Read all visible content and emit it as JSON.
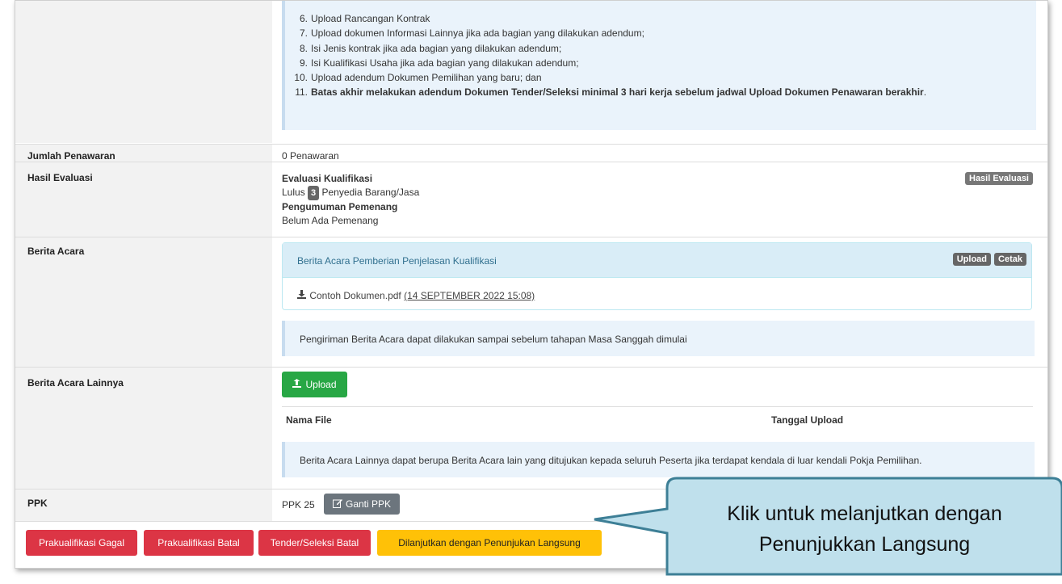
{
  "steps": [
    {
      "num": "6.",
      "text": "Upload Rancangan Kontrak"
    },
    {
      "num": "7.",
      "text": "Upload dokumen Informasi Lainnya jika ada bagian yang dilakukan adendum;"
    },
    {
      "num": "8.",
      "text": "Isi Jenis kontrak jika ada bagian yang dilakukan adendum;"
    },
    {
      "num": "9.",
      "text": "Isi Kualifikasi Usaha jika ada bagian yang dilakukan adendum;"
    },
    {
      "num": "10.",
      "text": "Upload adendum Dokumen Pemilihan yang baru; dan"
    },
    {
      "num": "11.",
      "text": "Batas akhir melakukan adendum Dokumen Tender/Seleksi minimal 3 hari kerja sebelum jadwal Upload Dokumen Penawaran berakhir",
      "suffix": "."
    }
  ],
  "jumlah": {
    "label": "Jumlah Penawaran",
    "value": "0 Penawaran"
  },
  "hasil": {
    "label": "Hasil Evaluasi",
    "badge": "Hasil Evaluasi",
    "evaluasi_title": "Evaluasi Kualifikasi",
    "lulus": "Lulus",
    "count": "3",
    "penyedia": "Penyedia Barang/Jasa",
    "pengumuman_title": "Pengumuman Pemenang",
    "pemenang": "Belum Ada Pemenang"
  },
  "berita": {
    "label": "Berita Acara",
    "panel_title": "Berita Acara Pemberian Penjelasan Kualifikasi",
    "upload": "Upload",
    "cetak": "Cetak",
    "file_name": "Contoh Dokumen.pdf",
    "file_date": "(14 SEPTEMBER 2022 15:08)",
    "note": "Pengiriman Berita Acara dapat dilakukan sampai sebelum tahapan Masa Sanggah dimulai"
  },
  "lainnya": {
    "label": "Berita Acara Lainnya",
    "upload_btn": "Upload",
    "col_file": "Nama File",
    "col_tanggal": "Tanggal Upload",
    "note": "Berita Acara Lainnya dapat berupa Berita Acara lain yang ditujukan kepada seluruh Peserta jika terdapat kendala di luar kendali Pokja Pemilihan."
  },
  "ppk": {
    "label": "PPK",
    "value": "PPK 25",
    "ganti": "Ganti PPK"
  },
  "actions": {
    "gagal": "Prakualifikasi Gagal",
    "batal": "Prakualifikasi Batal",
    "tender_batal": "Tender/Seleksi Batal",
    "lanjut": "Dilanjutkan dengan Penunjukan Langsung"
  },
  "callout": {
    "line1": "Klik untuk melanjutkan dengan",
    "line2": "Penunjukkan Langsung"
  },
  "colors": {
    "green": "#28a745",
    "red": "#dc3545",
    "yellow": "#ffc107",
    "callout": "#bfe0ec"
  }
}
